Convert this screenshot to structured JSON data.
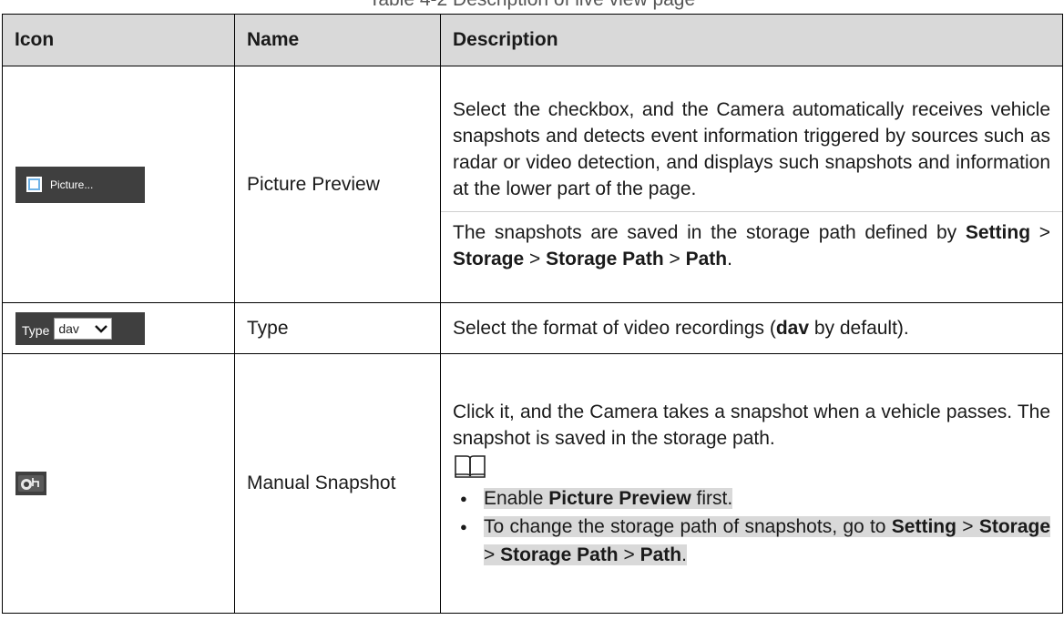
{
  "caption": "Table 4-2 Description of live view page",
  "table": {
    "headers": [
      "Icon",
      "Name",
      "Description"
    ],
    "rows": [
      {
        "icon": "picture-preview-checkbox-icon",
        "icon_label": "Picture...",
        "name": "Picture Preview",
        "desc1": "Select the checkbox, and the Camera automatically receives vehicle snapshots and detects event information triggered by sources such as radar or video detection, and displays such snapshots and information at the lower part of the page.",
        "desc2_pre": "The snapshots are saved in the storage path defined by ",
        "path": [
          "Setting",
          "Storage",
          "Storage Path",
          "Path"
        ],
        "sep": " > ",
        "end": "."
      },
      {
        "icon": "type-select-icon",
        "icon_label": "Type",
        "icon_value": "dav",
        "name": "Type",
        "desc_pre": "Select the format of video recordings (",
        "desc_bold": "dav",
        "desc_post": " by default)."
      },
      {
        "icon": "manual-snapshot-icon",
        "name": "Manual Snapshot",
        "desc1": "Click it, and the Camera takes a snapshot when a vehicle passes. The snapshot is saved in the storage path.",
        "note_icon": "book-note-icon",
        "bullet1_pre": "Enable ",
        "bullet1_bold": "Picture Preview",
        "bullet1_post": " first.",
        "bullet2": "To change the storage path of snapshots, go to ",
        "path": [
          "Setting",
          "Storage",
          "Storage Path",
          "Path"
        ],
        "sep": " > ",
        "end": "."
      }
    ]
  }
}
